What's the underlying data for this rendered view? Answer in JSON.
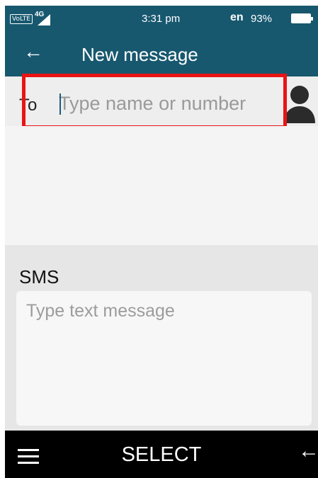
{
  "status_bar": {
    "volte": "VoLTE",
    "network": "4G",
    "time": "3:31 pm",
    "language": "en",
    "battery": "93%"
  },
  "app_bar": {
    "back_icon": "back-arrow-icon",
    "title": "New message"
  },
  "to_field": {
    "label": "To",
    "placeholder": "Type name or number",
    "value": "",
    "contact_icon": "contact-person-icon"
  },
  "sms": {
    "label": "SMS",
    "placeholder": "Type text message",
    "value": ""
  },
  "soft_keys": {
    "left_icon": "menu-icon",
    "center": "SELECT",
    "right_icon": "back-arrow-icon"
  },
  "colors": {
    "header": "#17586f",
    "highlight": "#ea1414",
    "softkey_bar": "#000000"
  }
}
